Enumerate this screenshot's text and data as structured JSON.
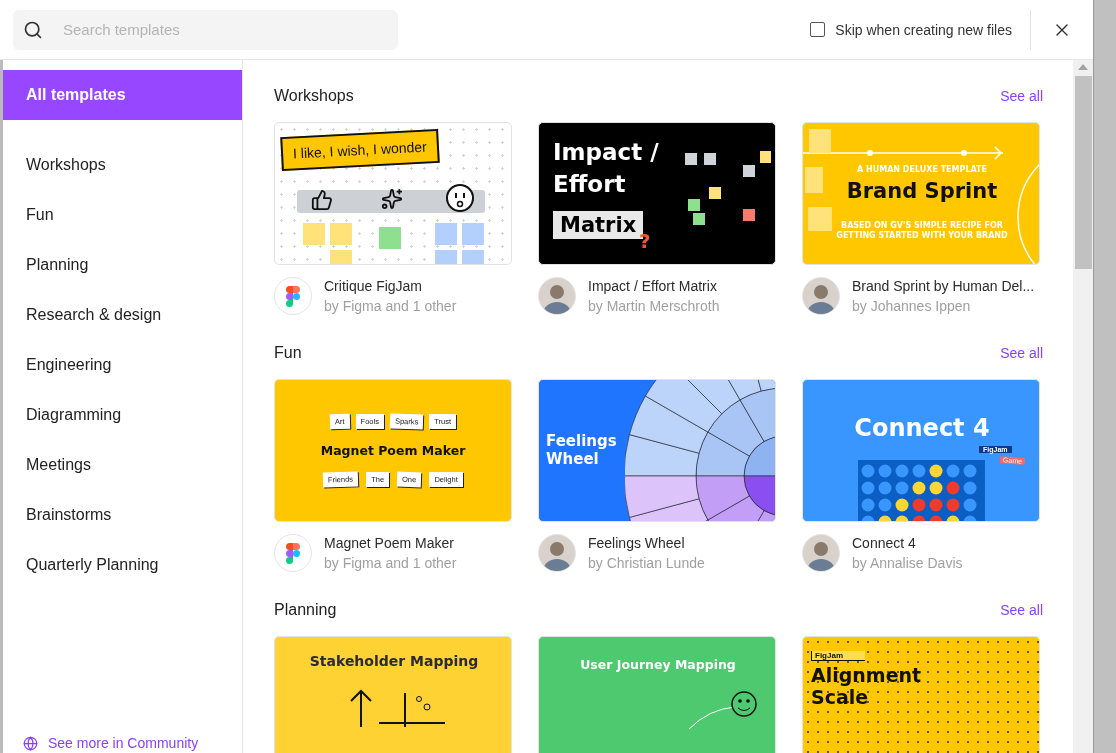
{
  "search": {
    "placeholder": "Search templates"
  },
  "skip_option": {
    "label": "Skip when creating new files",
    "checked": false
  },
  "sidebar": {
    "items": [
      {
        "label": "All templates",
        "selected": true
      },
      {
        "label": "Workshops",
        "selected": false
      },
      {
        "label": "Fun",
        "selected": false
      },
      {
        "label": "Planning",
        "selected": false
      },
      {
        "label": "Research & design",
        "selected": false
      },
      {
        "label": "Engineering",
        "selected": false
      },
      {
        "label": "Diagramming",
        "selected": false
      },
      {
        "label": "Meetings",
        "selected": false
      },
      {
        "label": "Brainstorms",
        "selected": false
      },
      {
        "label": "Quarterly Planning",
        "selected": false
      }
    ],
    "community_link": "See more in Community"
  },
  "sections": [
    {
      "title": "Workshops",
      "see_all": "See all",
      "cards": [
        {
          "thumb": {
            "kind": "critique",
            "texts": [
              "I like, I wish, I wonder"
            ]
          },
          "title": "Critique FigJam",
          "author": "by Figma and 1 other",
          "avatar": {
            "kind": "figma"
          }
        },
        {
          "thumb": {
            "kind": "impact",
            "texts": [
              "Impact /",
              "Effort",
              "Matrix",
              "?"
            ]
          },
          "title": "Impact / Effort Matrix",
          "author": "by Martin Merschroth",
          "avatar": {
            "kind": "person"
          }
        },
        {
          "thumb": {
            "kind": "brand",
            "texts": [
              "A HUMAN DELUXE TEMPLATE",
              "Brand Sprint",
              "BASED ON GV'S SIMPLE RECIPE FOR GETTING STARTED WITH YOUR BRAND"
            ]
          },
          "title": "Brand Sprint by Human Del...",
          "author": "by Johannes Ippen",
          "avatar": {
            "kind": "person"
          }
        }
      ]
    },
    {
      "title": "Fun",
      "see_all": "See all",
      "cards": [
        {
          "thumb": {
            "kind": "magnet",
            "texts": [
              "Art",
              "Fools",
              "Sparks",
              "Trust",
              "Magnet Poem Maker",
              "Friends",
              "The",
              "One",
              "Delight"
            ]
          },
          "title": "Magnet Poem Maker",
          "author": "by Figma and 1 other",
          "avatar": {
            "kind": "figma"
          }
        },
        {
          "thumb": {
            "kind": "feelings",
            "texts": [
              "Feelings Wheel"
            ]
          },
          "title": "Feelings Wheel",
          "author": "by Christian Lunde",
          "avatar": {
            "kind": "person"
          }
        },
        {
          "thumb": {
            "kind": "connect",
            "texts": [
              "Connect 4",
              "FigJam",
              "Game"
            ]
          },
          "title": "Connect 4",
          "author": "by Annalise Davis",
          "avatar": {
            "kind": "person"
          }
        }
      ]
    },
    {
      "title": "Planning",
      "see_all": "See all",
      "cards": [
        {
          "thumb": {
            "kind": "stakeholder",
            "texts": [
              "Stakeholder Mapping"
            ]
          }
        },
        {
          "thumb": {
            "kind": "journey",
            "texts": [
              "User Journey Mapping"
            ]
          }
        },
        {
          "thumb": {
            "kind": "alignment",
            "texts": [
              "FigJam",
              "Alignment Scale"
            ]
          }
        }
      ]
    }
  ]
}
